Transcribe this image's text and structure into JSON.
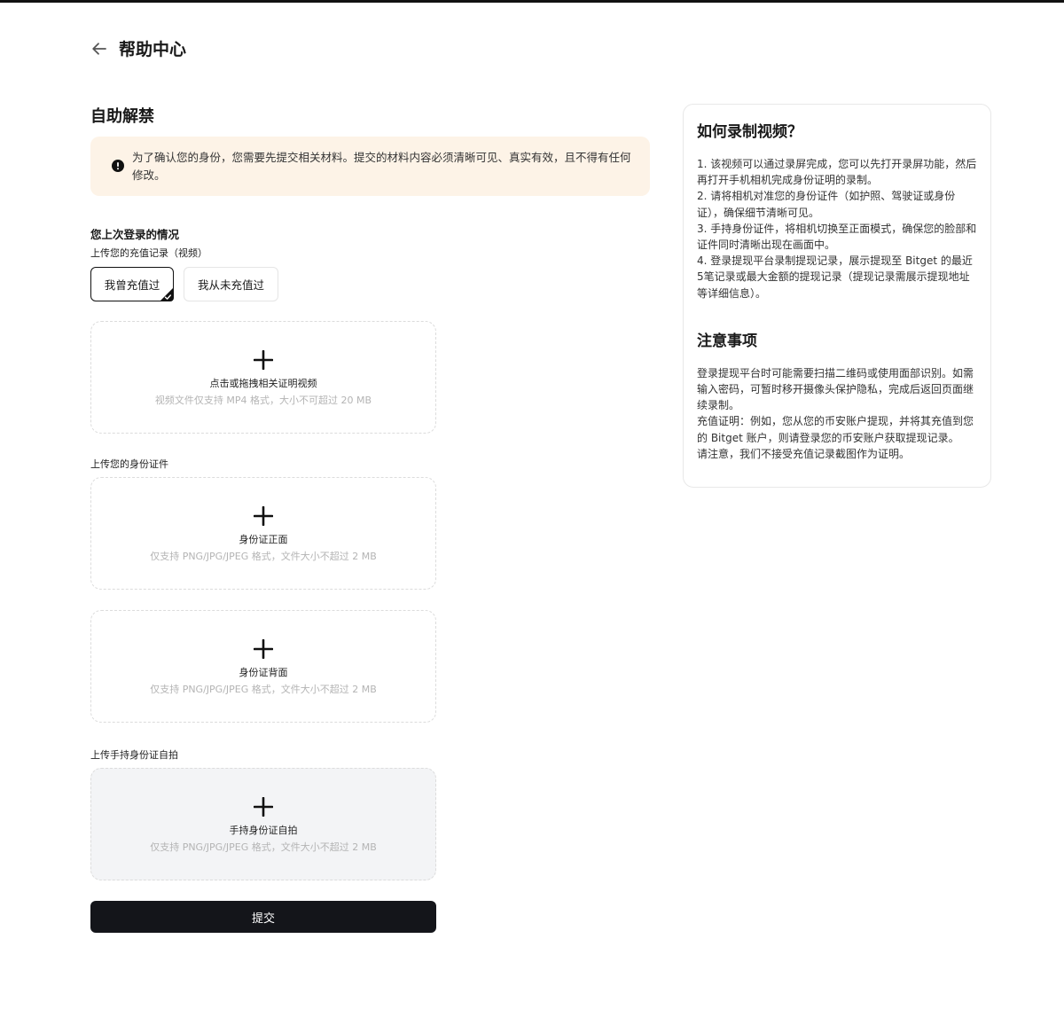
{
  "header": {
    "title": "帮助中心"
  },
  "section_title": "自助解禁",
  "notice": "为了确认您的身份，您需要先提交相关材料。提交的材料内容必须清晰可见、真实有效，且不得有任何修改。",
  "last_login": {
    "title": "您上次登录的情况",
    "recharge_label": "上传您的充值记录（视频）",
    "options": [
      "我曾充值过",
      "我从未充值过"
    ],
    "selected_option": "我曾充值过"
  },
  "uploads": {
    "video": {
      "title": "点击或拖拽相关证明视频",
      "hint": "视频文件仅支持 MP4 格式，大小不可超过 20 MB"
    },
    "id_label": "上传您的身份证件",
    "id_front": {
      "title": "身份证正面",
      "hint": "仅支持 PNG/JPG/JPEG 格式，文件大小不超过 2 MB"
    },
    "id_back": {
      "title": "身份证背面",
      "hint": "仅支持 PNG/JPG/JPEG 格式，文件大小不超过 2 MB"
    },
    "selfie_label": "上传手持身份证自拍",
    "selfie": {
      "title": "手持身份证自拍",
      "hint": "仅支持 PNG/JPG/JPEG 格式，文件大小不超过 2 MB"
    }
  },
  "submit_label": "提交",
  "help": {
    "how_title": "如何录制视频？",
    "steps": [
      "1. 该视频可以通过录屏完成，您可以先打开录屏功能，然后再打开手机相机完成身份证明的录制。",
      "2. 请将相机对准您的身份证件（如护照、驾驶证或身份证），确保细节清晰可见。",
      "3. 手持身份证件，将相机切换至正面模式，确保您的脸部和证件同时清晰出现在画面中。",
      "4. 登录提现平台录制提现记录，展示提现至 Bitget 的最近5笔记录或最大金额的提现记录（提现记录需展示提现地址等详细信息）。"
    ],
    "notes_title": "注意事项",
    "notes": [
      "登录提现平台时可能需要扫描二维码或使用面部识别。如需输入密码，可暂时移开摄像头保护隐私，完成后返回页面继续录制。",
      "充值证明：例如，您从您的币安账户提现，并将其充值到您的 Bitget 账户，则请登录您的币安账户获取提现记录。",
      "请注意，我们不接受充值记录截图作为证明。"
    ]
  }
}
